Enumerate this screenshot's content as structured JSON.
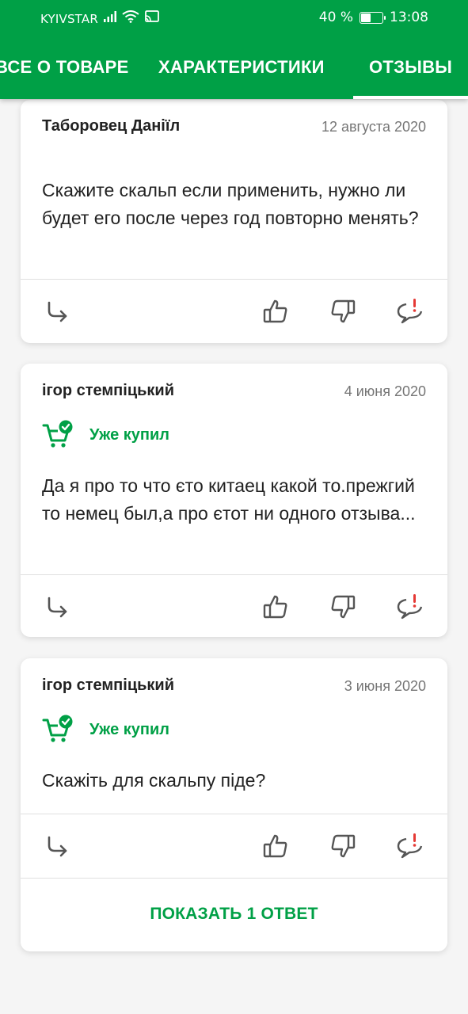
{
  "status_bar": {
    "carrier": "KYIVSTAR",
    "battery": "40 %",
    "time": "13:08",
    "icons": [
      "signal-icon",
      "wifi-icon",
      "cast-icon",
      "battery-icon"
    ]
  },
  "tabs": [
    {
      "label": "ВСЕ О ТОВАРЕ",
      "active": false
    },
    {
      "label": "ХАРАКТЕРИСТИКИ",
      "active": false
    },
    {
      "label": "ОТЗЫВЫ",
      "active": true
    }
  ],
  "colors": {
    "brand": "#00a046",
    "report": "#e53935"
  },
  "reviews": [
    {
      "author": "Таборовец Даніїл",
      "date": "12 августа 2020",
      "bought": false,
      "text": "Скажите скальп если применить, нужно ли будет его после через год повторно менять?"
    },
    {
      "author": "ігор стемпіцький",
      "date": "4 июня 2020",
      "bought": true,
      "bought_label": "Уже купил",
      "text": "Да я про то что єто китаец какой то.прежгий то немец был,а про єтот ни одного отзыва..."
    },
    {
      "author": "ігор стемпіцький",
      "date": "3 июня 2020",
      "bought": true,
      "bought_label": "Уже купил",
      "text": "Скажіть для скальпу піде?",
      "show_replies": "ПОКАЗАТЬ 1 ОТВЕТ"
    }
  ],
  "action_icons": [
    "reply-icon",
    "like-icon",
    "dislike-icon",
    "report-icon"
  ]
}
